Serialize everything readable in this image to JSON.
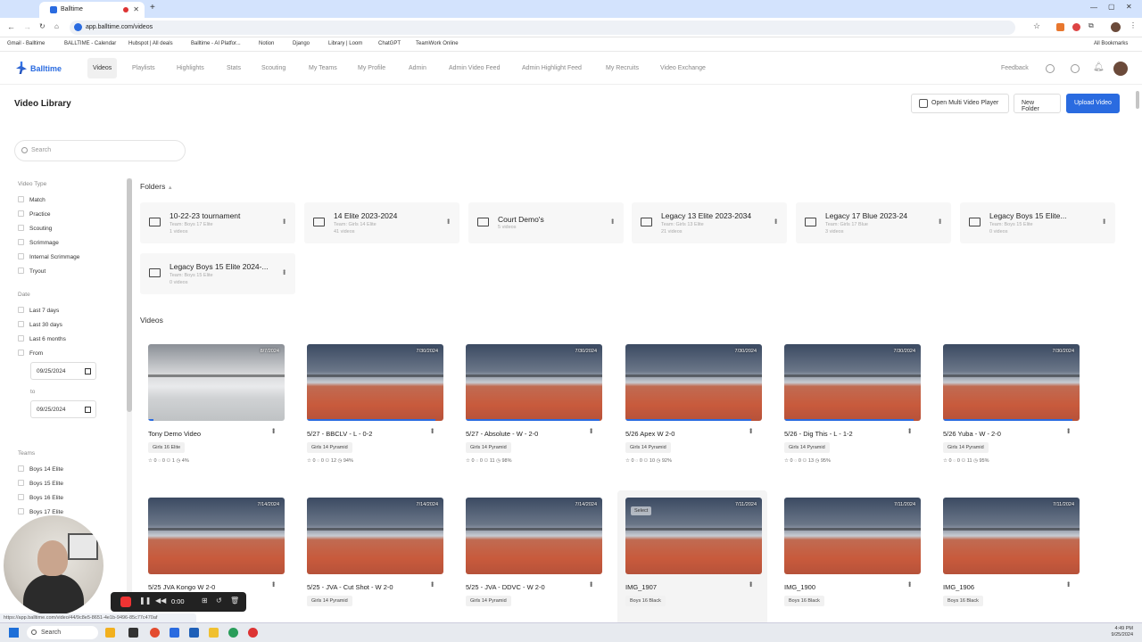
{
  "browser": {
    "tab_title": "Balltime",
    "url": "app.balltime.com/videos",
    "bookmarks": [
      "Gmail - Balltime",
      "BALLTIME - Calendar",
      "Hubspot | All deals",
      "Balltime - AI Platfor...",
      "Notion",
      "Django",
      "Library | Loom",
      "ChatGPT",
      "TeamWork Online"
    ],
    "all_bookmarks": "All Bookmarks"
  },
  "nav": {
    "brand": "Balltime",
    "items": [
      "Videos",
      "Playlists",
      "Highlights",
      "Stats",
      "Scouting",
      "My Teams",
      "My Profile",
      "Admin",
      "Admin Video Feed",
      "Admin Highlight Feed",
      "My Recruits",
      "Video Exchange"
    ],
    "feedback": "Feedback"
  },
  "header": {
    "title": "Video Library",
    "multi_player": "Open Multi Video Player",
    "new_folder": "New Folder",
    "upload": "Upload Video"
  },
  "sidebar": {
    "search_placeholder": "Search",
    "video_type_label": "Video Type",
    "video_types": [
      "Match",
      "Practice",
      "Scouting",
      "Scrimmage",
      "Internal Scrimmage",
      "Tryout"
    ],
    "date_label": "Date",
    "dates": [
      "Last 7 days",
      "Last 30 days",
      "Last 6 months"
    ],
    "from_label": "From",
    "from_value": "09/25/2024",
    "to_label": "to",
    "to_value": "09/25/2024",
    "teams_label": "Teams",
    "teams": [
      "Boys 14 Elite",
      "Boys 15 Elite",
      "Boys 16 Elite",
      "Boys 17 Elite"
    ]
  },
  "folders_title": "Folders",
  "folders": [
    {
      "name": "10-22-23 tournament",
      "team": "Team: Boys 17 Elite",
      "count": "1 videos"
    },
    {
      "name": "14 Elite 2023-2024",
      "team": "Team: Girls 14 Elite",
      "count": "41 videos"
    },
    {
      "name": "Court Demo's",
      "team": "",
      "count": "5 videos"
    },
    {
      "name": "Legacy 13 Elite 2023-2034",
      "team": "Team: Girls 13 Elite",
      "count": "21 videos"
    },
    {
      "name": "Legacy 17 Blue 2023-24",
      "team": "Team: Girls 17 Blue",
      "count": "3 videos"
    },
    {
      "name": "Legacy Boys 15 Elite...",
      "team": "Team: Boys 15 Elite",
      "count": "0 videos"
    },
    {
      "name": "Legacy Boys 15 Elite 2024-...",
      "team": "Team: Boys 15 Elite",
      "count": "0 videos"
    }
  ],
  "videos_title": "Videos",
  "videos": [
    {
      "title": "Tony Demo Video",
      "date": "8/7/2024",
      "tag": "Girls 16 Elite",
      "stats": "☆ 0  ◌ 0  ⚇ 1  ◷ 4%",
      "style": "gym",
      "progress": 0.04
    },
    {
      "title": "5/27 - BBCLV - L - 0-2",
      "date": "7/30/2024",
      "tag": "Girls 14 Pyramid",
      "stats": "☆ 0  ◌ 0  ⚇ 12  ◷ 94%",
      "style": "court",
      "progress": 0.94
    },
    {
      "title": "5/27 - Absolute - W - 2-0",
      "date": "7/30/2024",
      "tag": "Girls 14 Pyramid",
      "stats": "☆ 0  ◌ 0  ⚇ 11  ◷ 98%",
      "style": "court",
      "progress": 0.98
    },
    {
      "title": "5/26 Apex W 2-0",
      "date": "7/30/2024",
      "tag": "Girls 14 Pyramid",
      "stats": "☆ 0  ◌ 0  ⚇ 10  ◷ 92%",
      "style": "court",
      "progress": 0.92
    },
    {
      "title": "5/26 - Dig This - L - 1-2",
      "date": "7/30/2024",
      "tag": "Girls 14 Pyramid",
      "stats": "☆ 0  ◌ 0  ⚇ 13  ◷ 95%",
      "style": "court",
      "progress": 0.95
    },
    {
      "title": "5/26 Yuba - W - 2-0",
      "date": "7/30/2024",
      "tag": "Girls 14 Pyramid",
      "stats": "☆ 0  ◌ 0  ⚇ 11  ◷ 95%",
      "style": "court",
      "progress": 0.95
    },
    {
      "title": "5/25 JVA Kongo W 2-0",
      "date": "7/14/2024",
      "tag": "Girls 14 Pyramid",
      "stats": "",
      "style": "court",
      "progress": 0
    },
    {
      "title": "5/25 - JVA - Cut Shot - W 2-0",
      "date": "7/14/2024",
      "tag": "Girls 14 Pyramid",
      "stats": "",
      "style": "court",
      "progress": 0
    },
    {
      "title": "5/25 - JVA - DDVC - W 2-0",
      "date": "7/14/2024",
      "tag": "Girls 14 Pyramid",
      "stats": "",
      "style": "court",
      "progress": 0
    },
    {
      "title": "IMG_1907",
      "date": "7/11/2024",
      "tag": "Boys 16 Black",
      "stats": "",
      "style": "court",
      "progress": 0,
      "select": "Select"
    },
    {
      "title": "IMG_1900",
      "date": "7/11/2024",
      "tag": "Boys 16 Black",
      "stats": "",
      "style": "court",
      "progress": 0
    },
    {
      "title": "IMG_1906",
      "date": "7/11/2024",
      "tag": "Boys 16 Black",
      "stats": "",
      "style": "court",
      "progress": 0
    }
  ],
  "recorder": {
    "time": "0:00"
  },
  "status_url": "https://app.balltime.com/video/44/9c8e5-8651-4e1b-9496-85c77c470af",
  "taskbar": {
    "search": "Search",
    "time": "4:49 PM",
    "date": "9/25/2024"
  },
  "colors": {
    "accent": "#2a6be0",
    "court": "#c85a3c"
  }
}
